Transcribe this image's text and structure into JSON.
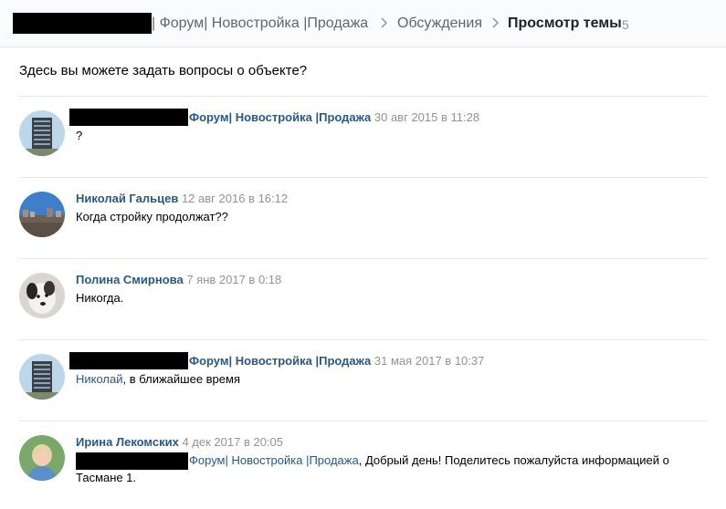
{
  "header": {
    "breadcrumbs": [
      {
        "label": "| Форум| Новостройка |Продажа"
      },
      {
        "label": "Обсуждения"
      },
      {
        "label": "Просмотр темы"
      }
    ],
    "count": "5"
  },
  "topic": {
    "subtitle": "Здесь вы можете задать вопросы о объекте?"
  },
  "posts": [
    {
      "author": "Форум| Новостройка |Продажа",
      "date": "30 авг 2015 в 11:28",
      "text": "?"
    },
    {
      "author": "Николай Гальцев",
      "date": "12 авг 2016 в 16:12",
      "text": "Когда стройку продолжат??"
    },
    {
      "author": "Полина Смирнова",
      "date": "7 янв 2017 в 0:18",
      "text": "Никогда."
    },
    {
      "author": "Форум| Новостройка |Продажа",
      "date": "31 мая 2017 в 10:37",
      "reply_to": "Николай",
      "text": ", в ближайшее время"
    },
    {
      "author": "Ирина Лекомских",
      "date": "4 дек 2017 в 20:05",
      "reply_to": "Форум| Новостройка |Продажа",
      "text": ", Добрый день! Поделитесь пожалуйста информацией о",
      "text_line2": "Тасмане 1."
    }
  ]
}
